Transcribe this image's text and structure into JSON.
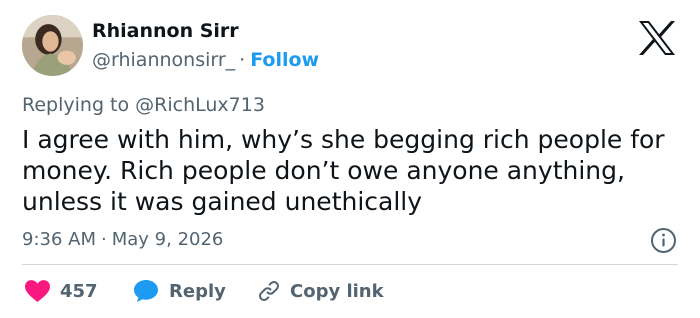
{
  "author": {
    "name": "Rhiannon Sirr",
    "handle": "@rhiannonsirr_",
    "separator": "·",
    "follow_label": "Follow"
  },
  "reply_context": {
    "prefix": "Replying to",
    "mention": "@RichLux713"
  },
  "tweet": {
    "text": "I agree with him, why’s she begging rich people for money. Rich people don’t owe anyone anything, unless it was gained unethically"
  },
  "meta": {
    "time": "9:36 AM",
    "separator": "·",
    "date": "May 9, 2026"
  },
  "actions": {
    "like_count": "457",
    "reply_label": "Reply",
    "copy_label": "Copy link"
  },
  "colors": {
    "like": "#f91880",
    "reply": "#1d9bf0",
    "follow": "#1d9bf0",
    "muted": "#536471",
    "text": "#0f1419"
  },
  "icons": [
    "x-logo-icon",
    "info-icon",
    "heart-icon",
    "speech-bubble-icon",
    "link-icon"
  ]
}
